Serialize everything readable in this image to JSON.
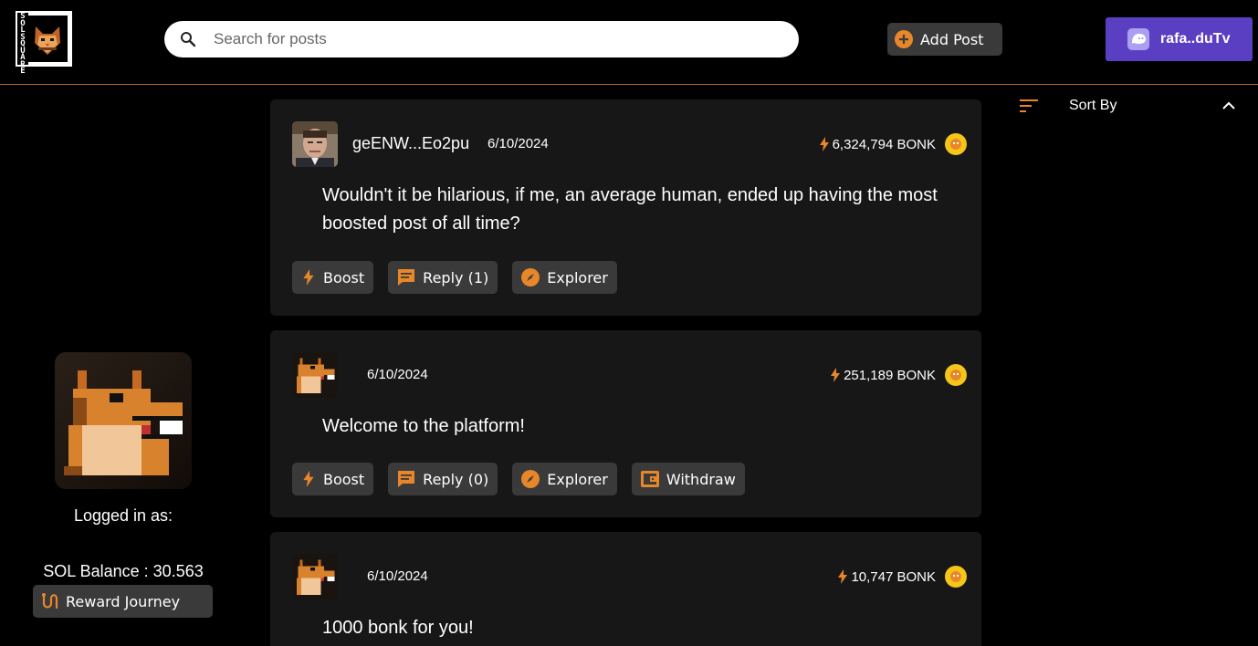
{
  "header": {
    "logo_text": "SOL SQUARE",
    "search_placeholder": "Search for posts",
    "add_post_label": "Add Post",
    "wallet_label": "rafa..duTv"
  },
  "sidebar": {
    "logged_in_label": "Logged in as:",
    "sol_balance": "SOL Balance : 30.563",
    "reward_label": "Reward Journey"
  },
  "sort": {
    "label": "Sort By"
  },
  "colors": {
    "accent": "#e8862a",
    "wallet": "#5b3fc2",
    "card": "#171717",
    "button": "#3a3a3a",
    "coin": "#f5c518"
  },
  "posts": [
    {
      "author": "geENW...Eo2pu",
      "date": "6/10/2024",
      "bonk": "6,324,794 BONK",
      "body": "Wouldn't it be hilarious, if me, an average human, ended up having the most boosted post of all time?",
      "boost_label": "Boost",
      "reply_label": "Reply (1)",
      "explorer_label": "Explorer"
    },
    {
      "author": "",
      "date": "6/10/2024",
      "bonk": "251,189 BONK",
      "body": "Welcome to the platform!",
      "boost_label": "Boost",
      "reply_label": "Reply (0)",
      "explorer_label": "Explorer",
      "withdraw_label": "Withdraw"
    },
    {
      "author": "",
      "date": "6/10/2024",
      "bonk": "10,747 BONK",
      "body": "1000 bonk for you!"
    }
  ]
}
